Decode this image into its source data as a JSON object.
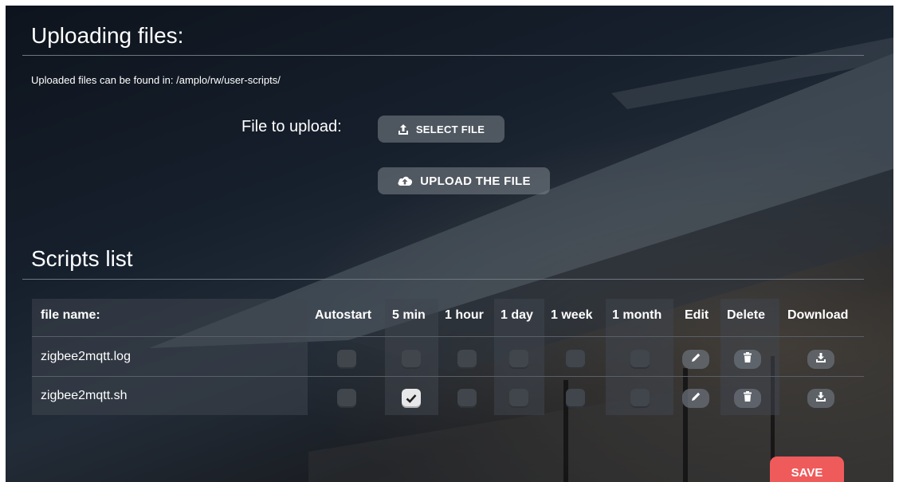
{
  "upload": {
    "title": "Uploading files:",
    "note": "Uploaded files can be found in: /amplo/rw/user-scripts/",
    "file_label": "File to upload:",
    "select_button": "SELECT FILE",
    "upload_button": "UPLOAD THE FILE"
  },
  "scripts": {
    "title": "Scripts list",
    "columns": {
      "file_name": "file name:",
      "autostart": "Autostart",
      "min5": "5 min",
      "hour1": "1 hour",
      "day1": "1 day",
      "week1": "1 week",
      "month1": "1 month",
      "edit": "Edit",
      "delete": "Delete",
      "download": "Download"
    },
    "rows": [
      {
        "name": "zigbee2mqtt.log",
        "autostart": false,
        "min5": false,
        "hour1": false,
        "day1": false,
        "week1": false,
        "month1": false
      },
      {
        "name": "zigbee2mqtt.sh",
        "autostart": false,
        "min5": true,
        "hour1": false,
        "day1": false,
        "week1": false,
        "month1": false
      }
    ]
  },
  "icons": {
    "select": "upload-tray-icon",
    "upload": "cloud-upload-icon",
    "edit": "pencil-icon",
    "delete": "trash-icon",
    "download": "download-tray-icon",
    "check": "check-icon"
  },
  "save_button": "SAVE",
  "colors": {
    "save": "#ef5b5b",
    "panel": "#161f2c"
  }
}
